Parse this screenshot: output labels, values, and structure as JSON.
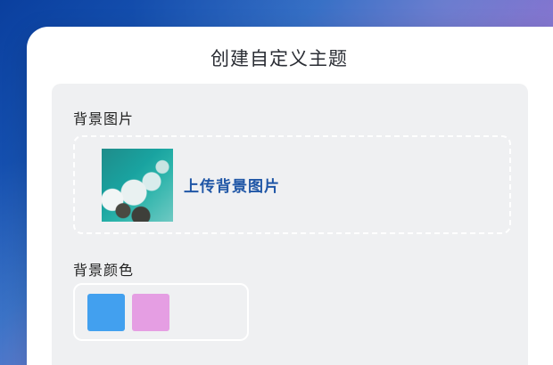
{
  "dialog": {
    "title": "创建自定义主题"
  },
  "background_image": {
    "label": "背景图片",
    "upload_label": "上传背景图片",
    "thumbnail_icon": "ocean-waves-image"
  },
  "background_color": {
    "label": "背景颜色",
    "swatches": [
      {
        "color": "#42a0ef"
      },
      {
        "color": "#e59ee3"
      }
    ]
  }
}
